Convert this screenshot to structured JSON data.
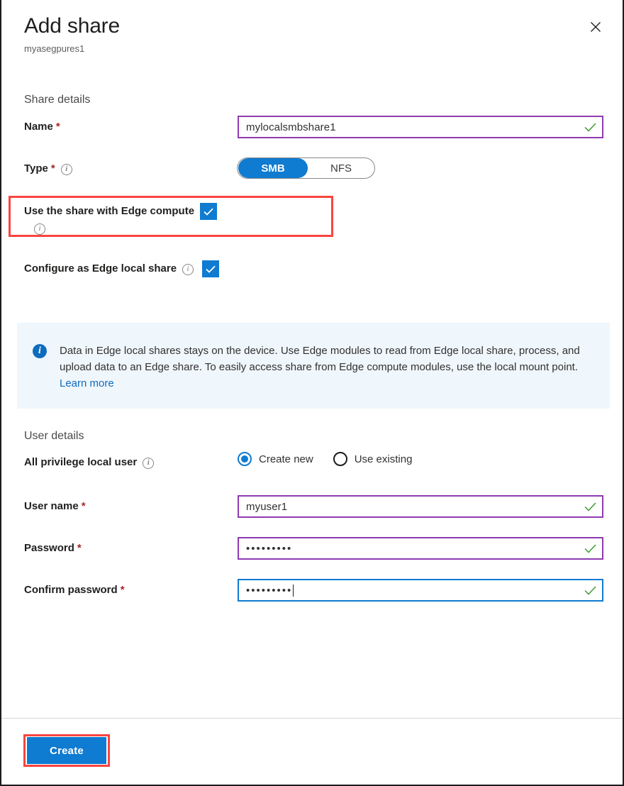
{
  "header": {
    "title": "Add share",
    "subtitle": "myasegpures1",
    "close_icon": "close-icon"
  },
  "share_details": {
    "section_label": "Share details",
    "name": {
      "label": "Name",
      "required_mark": "*",
      "value": "mylocalsmbshare1",
      "placeholder": "",
      "valid": true,
      "border_color": "#8e3bb0"
    },
    "type": {
      "label": "Type",
      "required_mark": "*",
      "info_icon": "info-icon",
      "options": [
        "SMB",
        "NFS"
      ],
      "selected": "SMB",
      "selected_color": "#0f7bd1"
    },
    "edge_compute": {
      "label": "Use the share with Edge compute",
      "checked": true,
      "info_icon": "info-icon",
      "check_icon": "checkmark-icon",
      "highlighted": true,
      "highlight_color": "#f9453e"
    },
    "edge_local_share": {
      "label": "Configure as Edge local share",
      "checked": true,
      "info_icon": "info-icon",
      "check_icon": "checkmark-icon"
    }
  },
  "info_banner": {
    "icon": "info-filled-icon",
    "text": "Data in Edge local shares stays on the device. Use Edge modules to read from Edge local share, process, and upload data to an Edge share. To easily access share from Edge compute modules, use the local mount point.",
    "link_text": "Learn more",
    "background": "#eff6fc"
  },
  "user_details": {
    "section_label": "User details",
    "all_privilege_user": {
      "label": "All privilege local user",
      "info_icon": "info-icon",
      "options": [
        "Create new",
        "Use existing"
      ],
      "selected": "Create new"
    },
    "user_name": {
      "label": "User name",
      "required_mark": "*",
      "value": "myuser1",
      "placeholder": "",
      "valid": true,
      "border_color": "#8e3bb0"
    },
    "password": {
      "label": "Password",
      "required_mark": "*",
      "value": "•••••••••",
      "placeholder": "",
      "valid": true,
      "border_color": "#8e3bb0"
    },
    "confirm_password": {
      "label": "Confirm password",
      "required_mark": "*",
      "value": "•••••••••",
      "placeholder": "",
      "valid": true,
      "focused": true,
      "border_color": "#0f7bd1"
    }
  },
  "footer": {
    "create_label": "Create",
    "create_color": "#0f7bd1",
    "highlighted": true,
    "highlight_color": "#f9453e"
  }
}
